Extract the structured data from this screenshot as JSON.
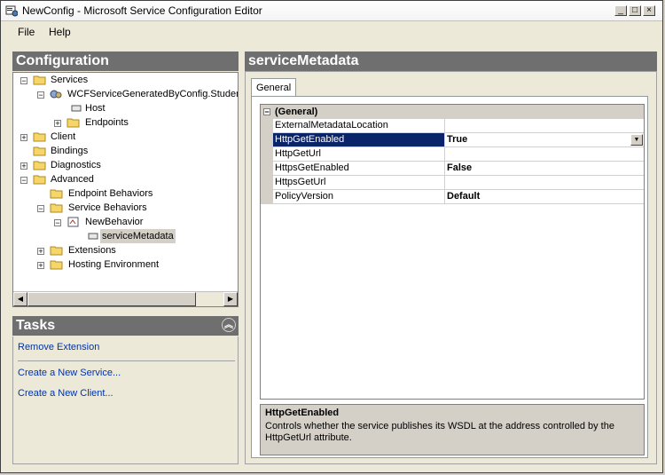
{
  "window": {
    "title": "NewConfig - Microsoft Service Configuration Editor"
  },
  "menu": {
    "file": "File",
    "help": "Help"
  },
  "config_panel": {
    "title": "Configuration"
  },
  "tree": {
    "services": "Services",
    "service_name": "WCFServiceGeneratedByConfig.Student",
    "host": "Host",
    "endpoints": "Endpoints",
    "client": "Client",
    "bindings": "Bindings",
    "diagnostics": "Diagnostics",
    "advanced": "Advanced",
    "endpoint_behaviors": "Endpoint Behaviors",
    "service_behaviors": "Service Behaviors",
    "new_behavior": "NewBehavior",
    "service_metadata": "serviceMetadata",
    "extensions": "Extensions",
    "hosting_environment": "Hosting Environment"
  },
  "tasks": {
    "title": "Tasks",
    "remove_extension": "Remove Extension",
    "create_service": "Create a New Service...",
    "create_client": "Create a New Client..."
  },
  "detail": {
    "title": "serviceMetadata",
    "tab_general": "General",
    "category": "(General)",
    "properties": [
      {
        "name": "ExternalMetadataLocation",
        "value": ""
      },
      {
        "name": "HttpGetEnabled",
        "value": "True"
      },
      {
        "name": "HttpGetUrl",
        "value": ""
      },
      {
        "name": "HttpsGetEnabled",
        "value": "False"
      },
      {
        "name": "HttpsGetUrl",
        "value": ""
      },
      {
        "name": "PolicyVersion",
        "value": "Default"
      }
    ],
    "description_title": "HttpGetEnabled",
    "description_text": "Controls whether the service publishes its WSDL at the address controlled by the HttpGetUrl attribute."
  }
}
